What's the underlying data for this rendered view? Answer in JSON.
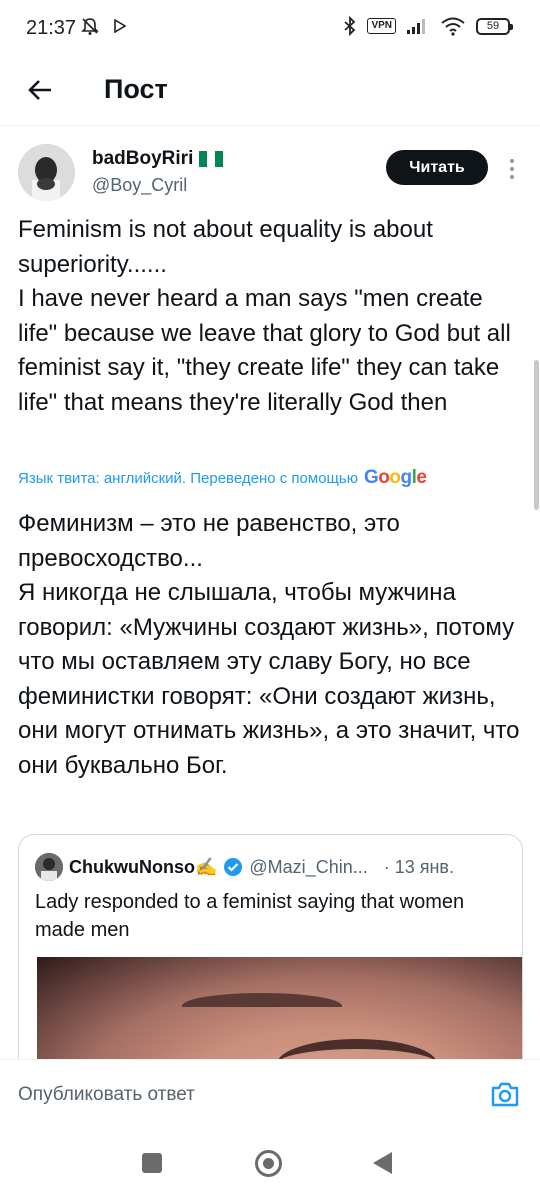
{
  "status_bar": {
    "time": "21:37",
    "vpn": "VPN",
    "battery": "59"
  },
  "header": {
    "title": "Пост"
  },
  "tweet": {
    "author_name": "badBoyRiri",
    "author_handle": "@Boy_Cyril",
    "follow_label": "Читать",
    "text": "Feminism is not about equality is about superiority......\nI have never heard a man says \"men create life\" because we leave that glory to God but all feminist say it, \"they create life\" they can take life\" that means they're literally God then",
    "translation_note": "Язык твита: английский. Переведено с помощью",
    "translation_provider": "Google",
    "translated_text": "Феминизм – это не равенство, это превосходство...\nЯ никогда не слышала, чтобы мужчина говорил: «Мужчины создают жизнь», потому что мы оставляем эту славу Богу, но все феминистки говорят: «Они создают жизнь, они могут отнимать жизнь», а это значит, что они буквально Бог."
  },
  "quote": {
    "author_name": "ChukwuNonso✍️",
    "author_handle": "@Mazi_Chin...",
    "date": "· 13 янв.",
    "text": "Lady responded to a feminist saying that women made men"
  },
  "reply_bar": {
    "placeholder": "Опубликовать ответ"
  },
  "colors": {
    "accent": "#1d9bf0",
    "text_primary": "#0f1419",
    "text_secondary": "#536471",
    "verified": "#1d9bf0"
  },
  "icons": {
    "back": "arrow-left-icon",
    "camera": "camera-icon",
    "more": "more-vertical-icon",
    "verified": "verified-badge-icon"
  }
}
